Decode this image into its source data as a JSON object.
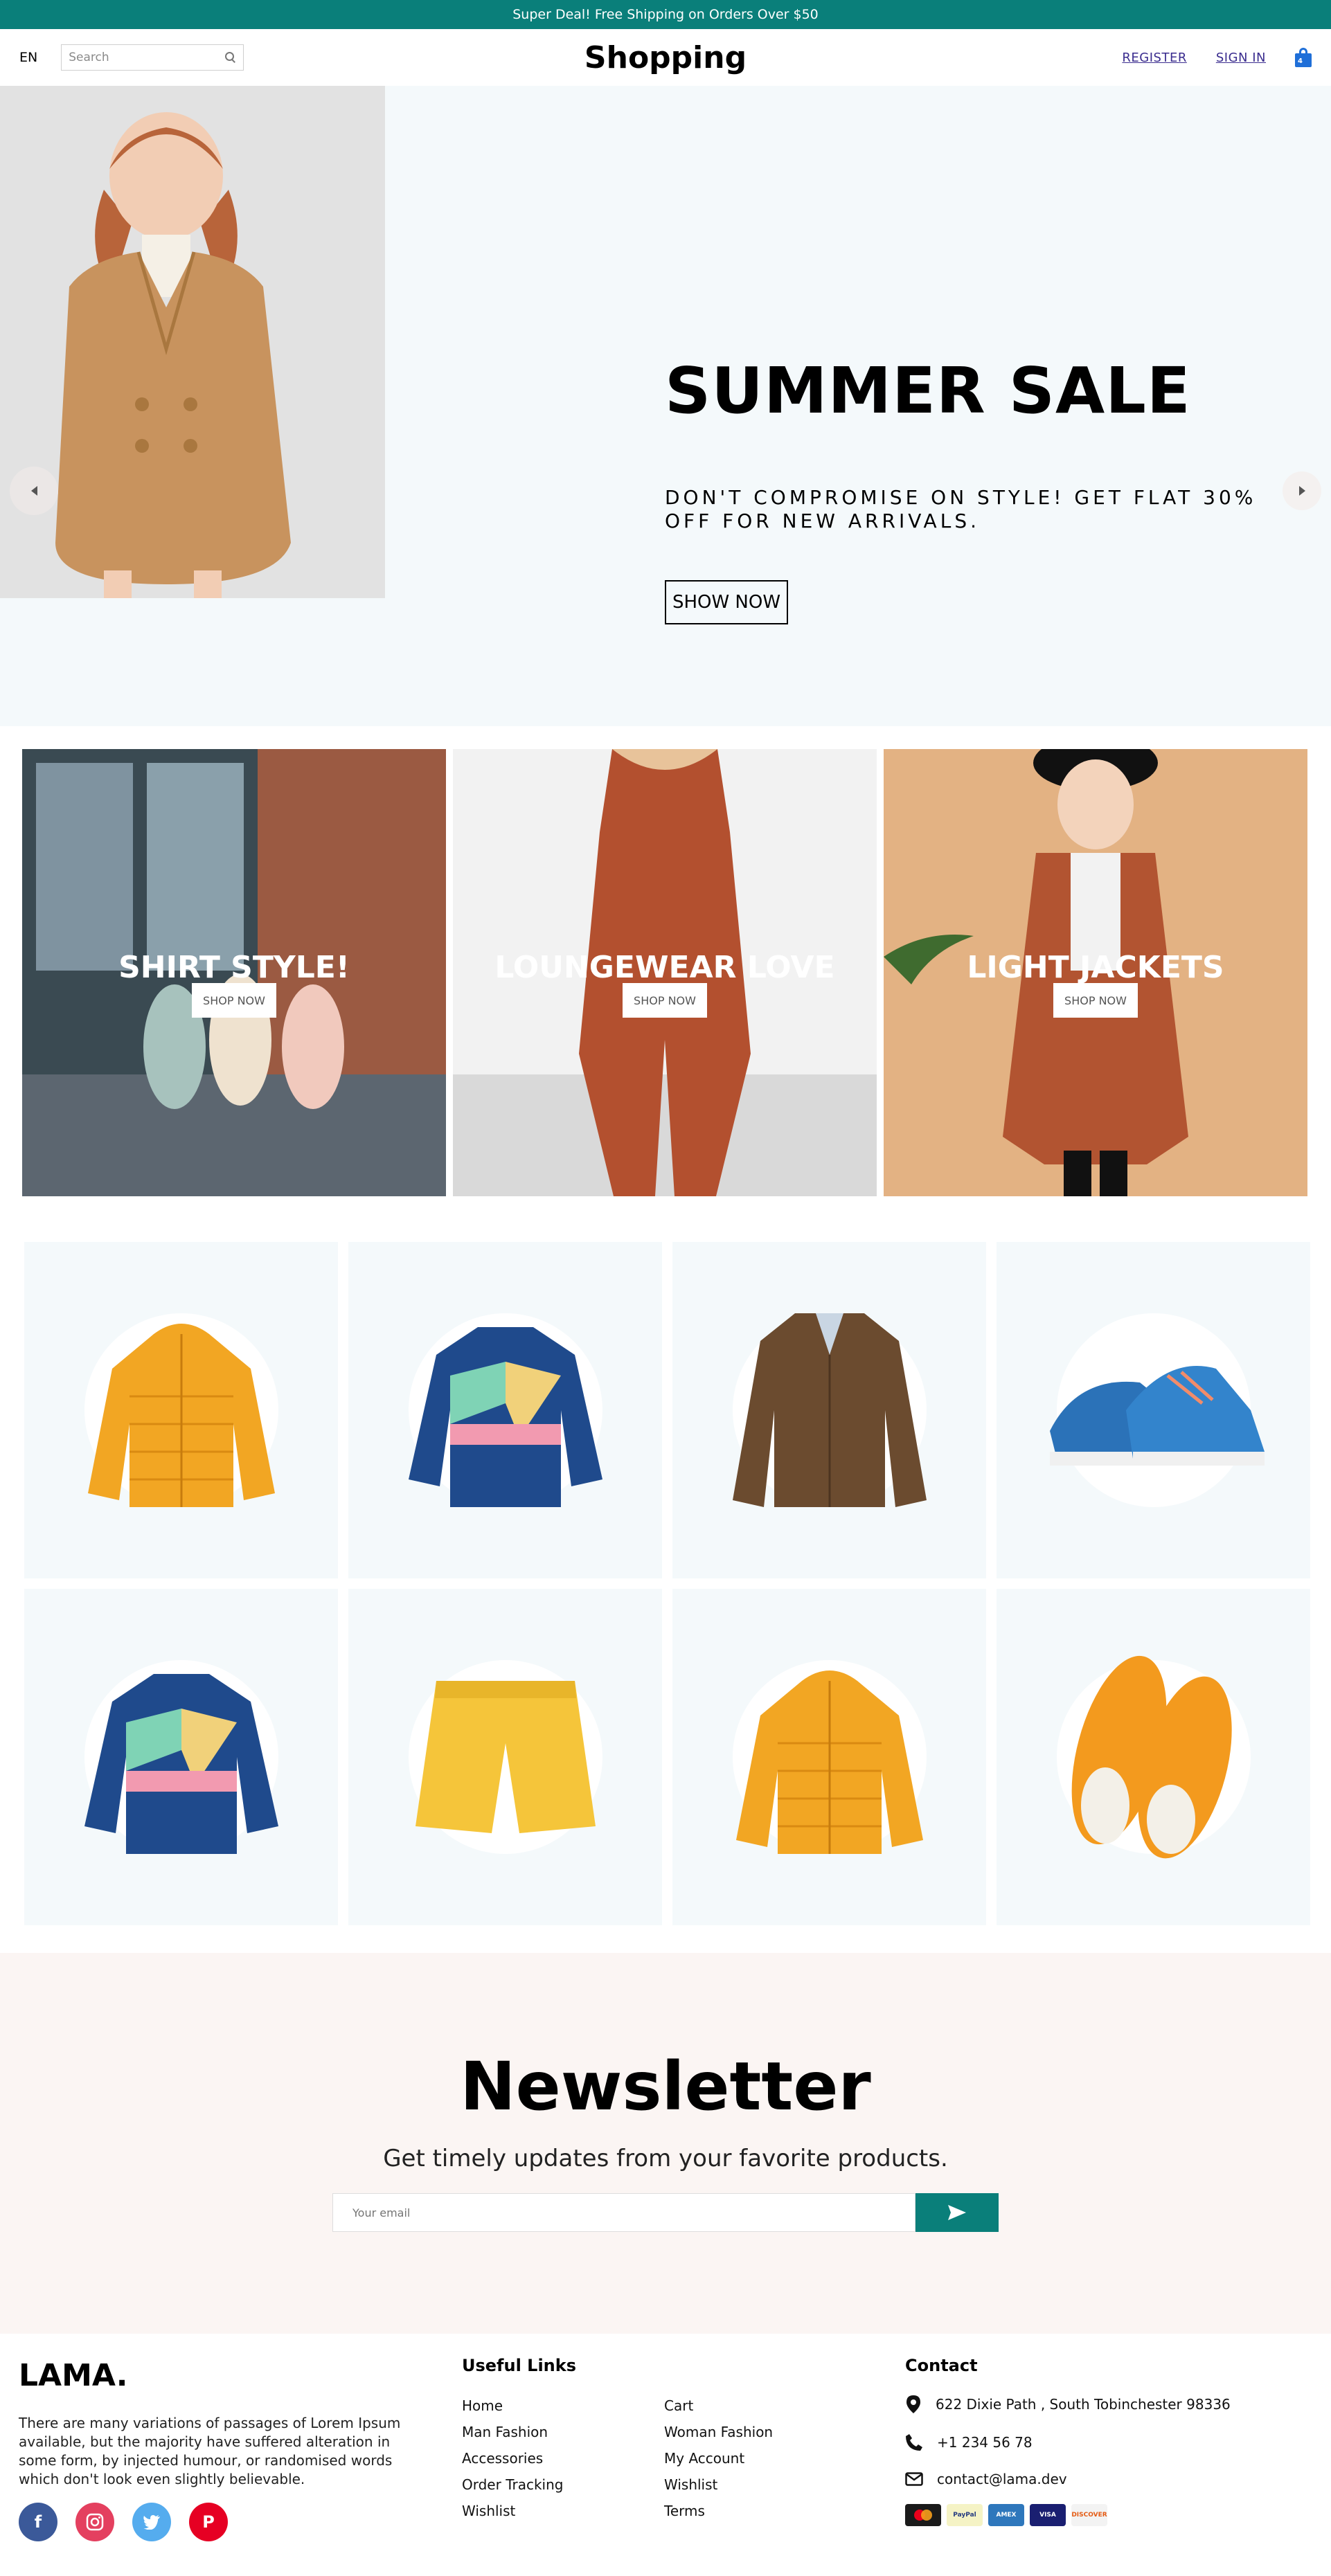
{
  "announcement": {
    "text": "Super Deal! Free Shipping on Orders Over $50"
  },
  "header": {
    "language": "EN",
    "search_placeholder": "Search",
    "logo": "Shopping",
    "register": "REGISTER",
    "sign_in": "SIGN IN",
    "cart_count": "4"
  },
  "hero": {
    "title": "SUMMER SALE",
    "description": "DON'T COMPROMISE ON STYLE! GET FLAT 30% OFF FOR NEW ARRIVALS.",
    "button": "SHOW NOW",
    "background": "#f4f9fb"
  },
  "categories": [
    {
      "title": "SHIRT STYLE!",
      "button": "SHOP NOW"
    },
    {
      "title": "LOUNGEWEAR LOVE",
      "button": "SHOP NOW"
    },
    {
      "title": "LIGHT JACKETS",
      "button": "SHOP NOW"
    }
  ],
  "products": [
    {
      "icon": "orange-puffer-jacket"
    },
    {
      "icon": "blue-windbreaker-jacket"
    },
    {
      "icon": "brown-leather-jacket"
    },
    {
      "icon": "blue-sneakers"
    },
    {
      "icon": "blue-windbreaker-jacket"
    },
    {
      "icon": "yellow-shorts"
    },
    {
      "icon": "orange-puffer-jacket"
    },
    {
      "icon": "orange-leather-shoes"
    }
  ],
  "newsletter": {
    "title": "Newsletter",
    "description": "Get timely updates from your favorite products.",
    "email_placeholder": "Your email"
  },
  "footer": {
    "logo": "LAMA.",
    "description": "There are many variations of passages of Lorem Ipsum available, but the majority have suffered alteration in some form, by injected humour, or randomised words which don't look even slightly believable.",
    "useful_links_title": "Useful Links",
    "links": [
      "Home",
      "Cart",
      "Man Fashion",
      "Woman Fashion",
      "Accessories",
      "My Account",
      "Order Tracking",
      "Wishlist",
      "Wishlist",
      "Terms"
    ],
    "contact_title": "Contact",
    "address": "622 Dixie Path , South Tobinchester 98336",
    "phone": "+1 234 56 78",
    "email": "contact@lama.dev",
    "payments": [
      "mastercard",
      "PayPal",
      "AMEX",
      "VISA",
      "DISCOVER"
    ]
  },
  "colors": {
    "accent": "#0a7f7a",
    "hero_bg": "#f4f9fb",
    "newsletter_bg": "#fbf5f3",
    "facebook": "#3b5999",
    "instagram": "#e4405f",
    "twitter": "#55acee",
    "pinterest": "#e60023"
  }
}
